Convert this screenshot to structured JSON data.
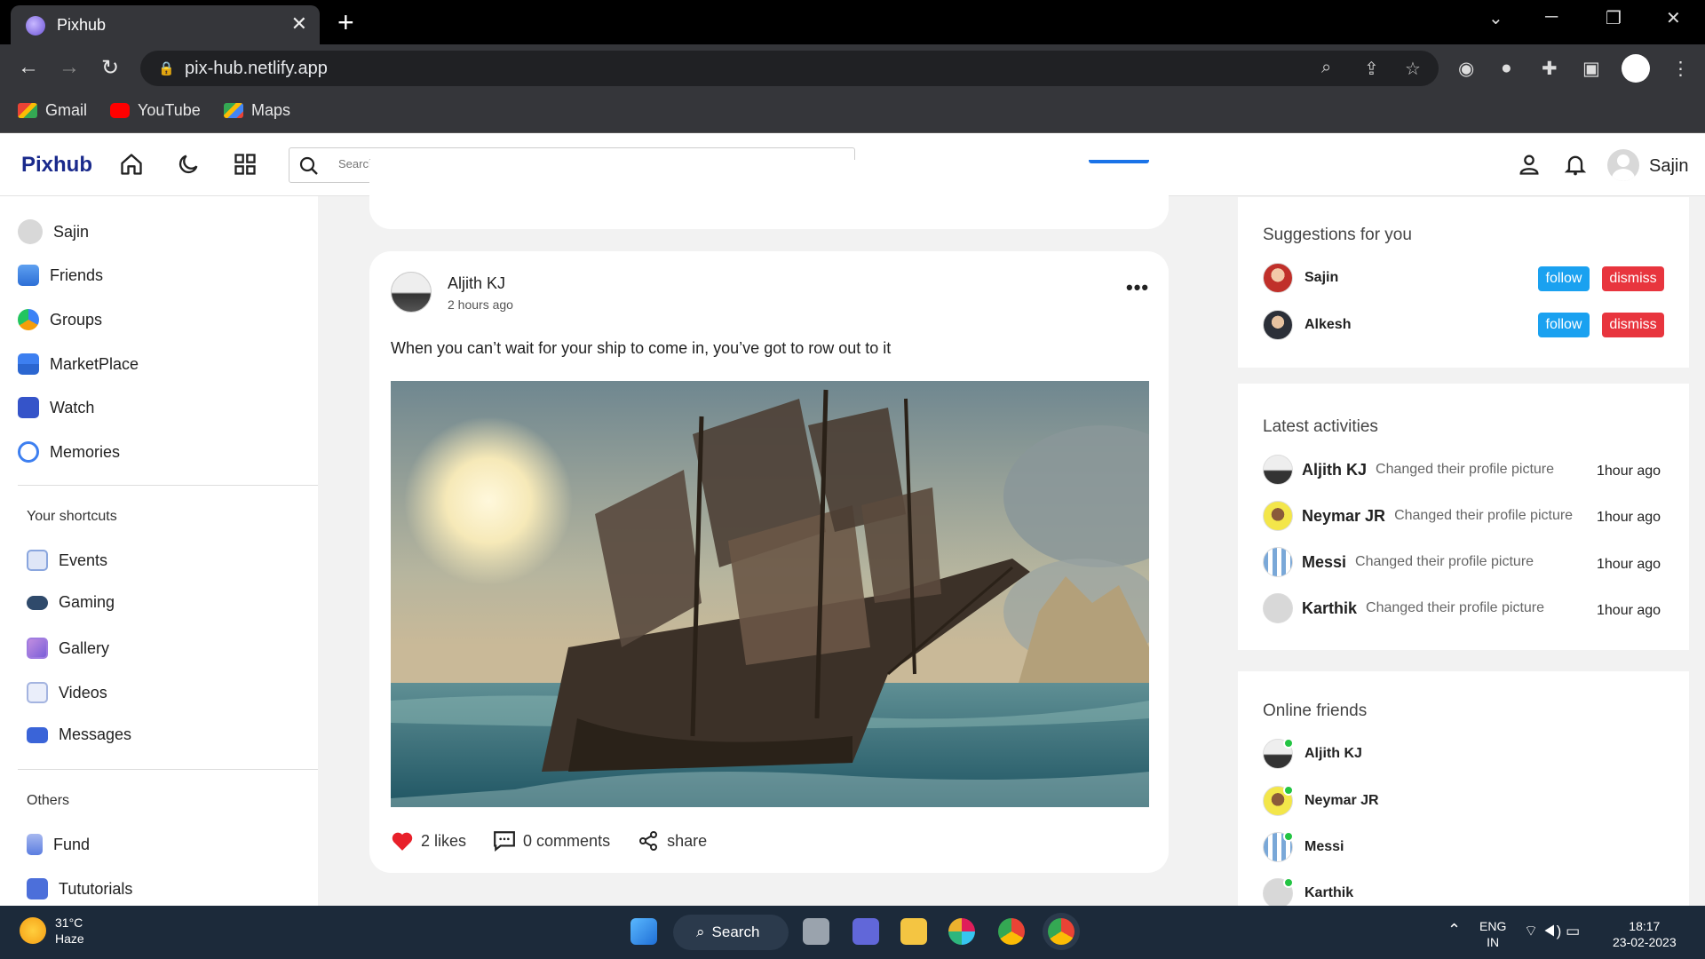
{
  "browser": {
    "tab_title": "Pixhub",
    "url": "pix-hub.netlify.app",
    "bookmarks": [
      "Gmail",
      "YouTube",
      "Maps"
    ]
  },
  "header": {
    "logo": "Pixhub",
    "search_placeholder": "Search...",
    "username": "Sajin"
  },
  "sidebar": {
    "user": "Sajin",
    "main_items": [
      "Friends",
      "Groups",
      "MarketPlace",
      "Watch",
      "Memories"
    ],
    "shortcuts_title": "Your shortcuts",
    "shortcuts": [
      "Events",
      "Gaming",
      "Gallery",
      "Videos",
      "Messages"
    ],
    "others_title": "Others",
    "others": [
      "Fund",
      "Tututorials"
    ]
  },
  "post": {
    "author": "Aljith KJ",
    "time": "2 hours ago",
    "text": "When you can’t wait for your ship to come in, you’ve got to row out to it",
    "likes": "2 likes",
    "comments": "0 comments",
    "share": "share"
  },
  "suggestions": {
    "title": "Suggestions for you",
    "follow_label": "follow",
    "dismiss_label": "dismiss",
    "users": [
      "Sajin",
      "Alkesh"
    ]
  },
  "activities": {
    "title": "Latest activities",
    "items": [
      {
        "name": "Aljith KJ",
        "desc": "Changed their profile picture",
        "time": "1hour ago"
      },
      {
        "name": "Neymar JR",
        "desc": "Changed their profile picture",
        "time": "1hour ago"
      },
      {
        "name": "Messi",
        "desc": "Changed their profile picture",
        "time": "1hour ago"
      },
      {
        "name": "Karthik",
        "desc": "Changed their profile picture",
        "time": "1hour ago"
      }
    ]
  },
  "online": {
    "title": "Online friends",
    "friends": [
      "Aljith KJ",
      "Neymar JR",
      "Messi",
      "Karthik"
    ]
  },
  "taskbar": {
    "temp": "31°C",
    "weather": "Haze",
    "search": "Search",
    "lang1": "ENG",
    "lang2": "IN",
    "time": "18:17",
    "date": "23-02-2023"
  },
  "colors": {
    "brand": "#1a2a8c",
    "follow": "#1aa1f0",
    "dismiss": "#e8353e",
    "online": "#23c443",
    "like": "#e8202a"
  }
}
